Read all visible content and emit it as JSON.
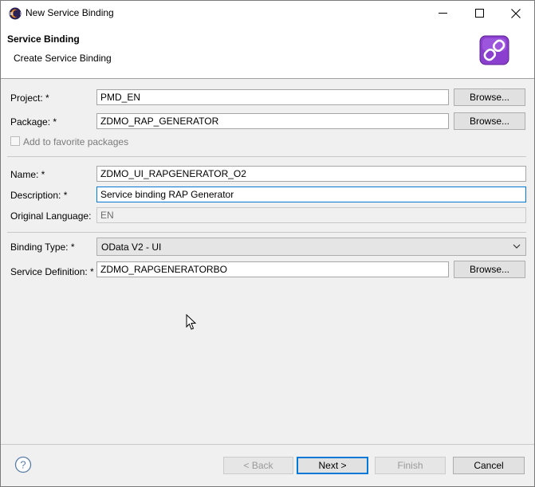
{
  "window": {
    "title": "New Service Binding",
    "controls": {
      "minimize": "minimize-icon",
      "maximize": "maximize-icon",
      "close": "close-icon"
    }
  },
  "header": {
    "title": "Service Binding",
    "subtitle": "Create Service Binding",
    "icon": "service-binding-icon"
  },
  "form": {
    "project": {
      "label": "Project: *",
      "value": "PMD_EN",
      "browse": "Browse..."
    },
    "package": {
      "label": "Package: *",
      "value": "ZDMO_RAP_GENERATOR",
      "browse": "Browse..."
    },
    "favorite": {
      "label": "Add to favorite packages",
      "checked": false
    },
    "name": {
      "label": "Name: *",
      "value": "ZDMO_UI_RAPGENERATOR_O2"
    },
    "description": {
      "label": "Description: *",
      "value": "Service binding RAP Generator"
    },
    "language": {
      "label": "Original Language:",
      "value": "EN"
    },
    "binding_type": {
      "label": "Binding Type: *",
      "value": "OData V2 - UI"
    },
    "service_definition": {
      "label": "Service Definition: *",
      "value": "ZDMO_RAPGENERATORBO",
      "browse": "Browse..."
    }
  },
  "footer": {
    "help_icon": "help-icon",
    "back": "< Back",
    "next": "Next >",
    "finish": "Finish",
    "cancel": "Cancel"
  },
  "colors": {
    "accent": "#0078d7",
    "header_icon": "#8b3fcf",
    "dialog_bg": "#f0f0f0"
  }
}
